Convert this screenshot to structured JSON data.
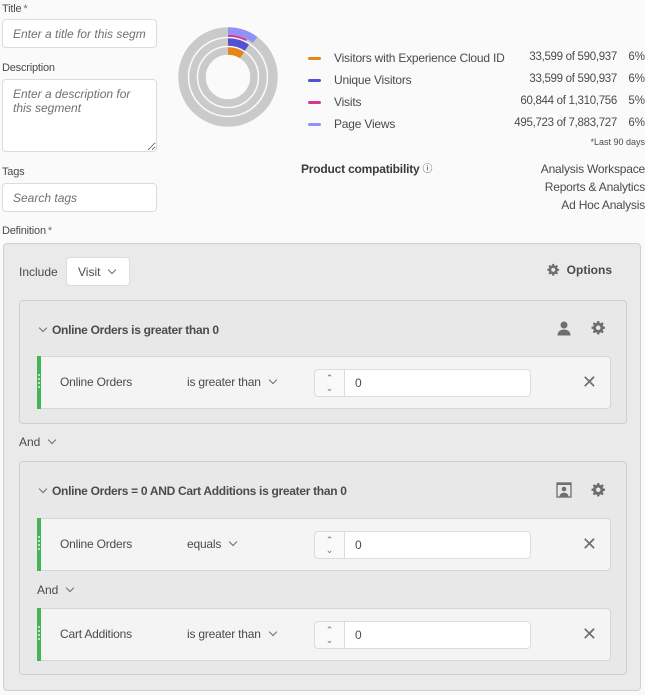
{
  "form": {
    "title_label": "Title",
    "title_required": "*",
    "title_placeholder": "Enter a title for this segm...",
    "description_label": "Description",
    "description_placeholder": "Enter a description for this segment",
    "tags_label": "Tags",
    "tags_placeholder": "Search tags",
    "definition_label": "Definition",
    "definition_required": "*"
  },
  "summary": {
    "metrics": [
      {
        "name": "Visitors with Experience Cloud ID",
        "count": "33,599 of 590,937",
        "pct": "6%",
        "fraction": 0.0569,
        "color": "#e68619"
      },
      {
        "name": "Unique Visitors",
        "count": "33,599 of 590,937",
        "pct": "6%",
        "fraction": 0.0569,
        "color": "#5151d3"
      },
      {
        "name": "Visits",
        "count": "60,844 of 1,310,756",
        "pct": "5%",
        "fraction": 0.0464,
        "color": "#d83790"
      },
      {
        "name": "Page Views",
        "count": "495,723 of 7,883,727",
        "pct": "6%",
        "fraction": 0.0629,
        "color": "#9191f7"
      }
    ],
    "footnote": "*Last 90 days",
    "ring_track_color": "#cacaca"
  },
  "compatibility": {
    "title": "Product compatibility",
    "info_icon": "ⓘ",
    "products": [
      "Analysis Workspace",
      "Reports & Analytics",
      "Ad Hoc Analysis"
    ]
  },
  "definition": {
    "include_label": "Include",
    "scope": "Visit",
    "options_label": "Options",
    "groups": [
      {
        "title": "Online Orders is greater than 0",
        "rules": [
          {
            "dimension": "Online Orders",
            "operator": "is greater than",
            "value": "0"
          }
        ]
      },
      {
        "title": "Online Orders = 0 AND Cart Additions is greater than 0",
        "rules": [
          {
            "dimension": "Online Orders",
            "operator": "equals",
            "value": "0"
          },
          {
            "dimension": "Cart Additions",
            "operator": "is greater than",
            "value": "0"
          }
        ],
        "inner_operator": "And"
      }
    ],
    "group_operator": "And",
    "accent_color": "#44b556"
  }
}
